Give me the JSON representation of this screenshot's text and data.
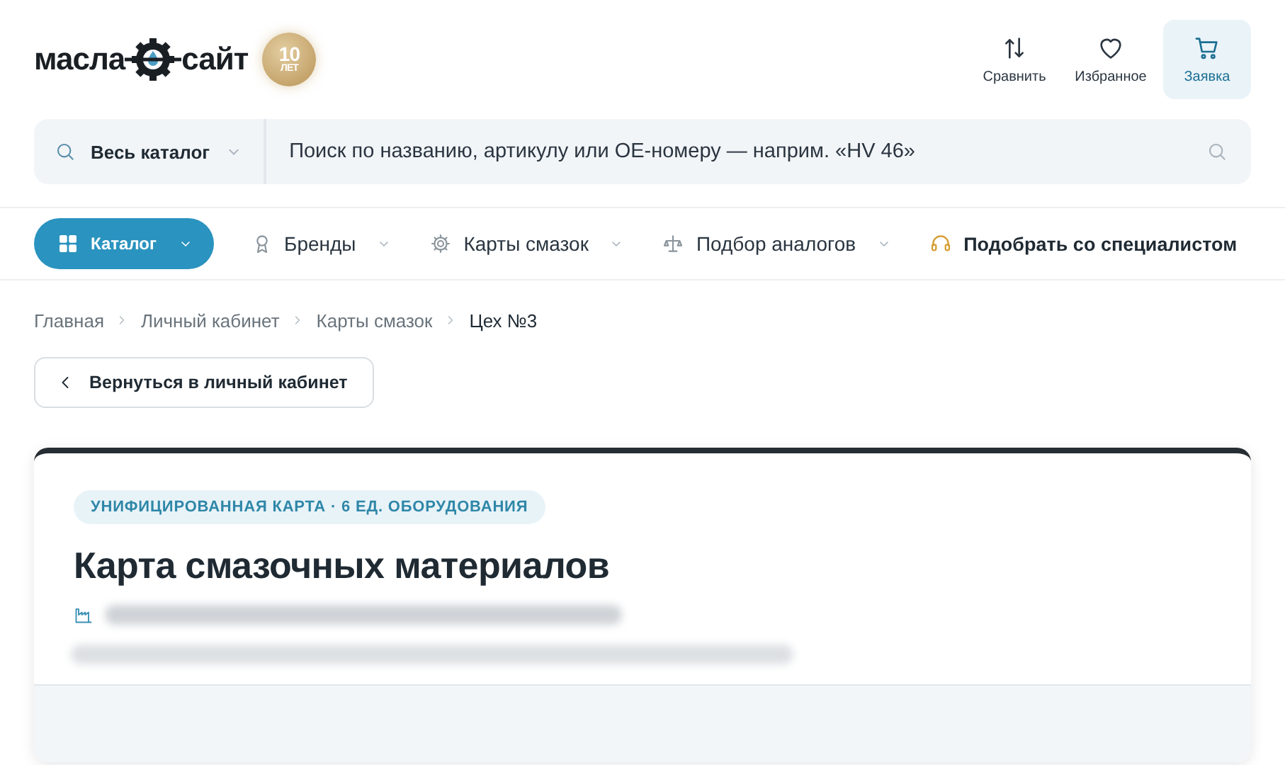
{
  "logo": {
    "left": "масла",
    "right": "сайт",
    "badge_number": "10",
    "badge_unit": "ЛЕТ"
  },
  "header_actions": [
    {
      "label": "Сравнить",
      "selected": false
    },
    {
      "label": "Избранное",
      "selected": false
    },
    {
      "label": "Заявка",
      "selected": true
    }
  ],
  "search": {
    "scope": "Весь каталог",
    "placeholder": "Поиск по названию, артикулу или ОЕ-номеру — наприм. «HV 46»"
  },
  "nav": [
    {
      "label": "Каталог",
      "kind": "primary"
    },
    {
      "label": "Бренды",
      "kind": "link"
    },
    {
      "label": "Карты смазок",
      "kind": "link"
    },
    {
      "label": "Подбор аналогов",
      "kind": "link"
    },
    {
      "label": "Подобрать со специалистом",
      "kind": "accent"
    }
  ],
  "breadcrumbs": [
    "Главная",
    "Личный кабинет",
    "Карты смазок",
    "Цех №3"
  ],
  "back_button": "Вернуться в личный кабинет",
  "card": {
    "tag": "УНИФИЦИРОВАННАЯ КАРТА · 6 ЕД. ОБОРУДОВАНИЯ",
    "title": "Карта смазочных материалов"
  }
}
